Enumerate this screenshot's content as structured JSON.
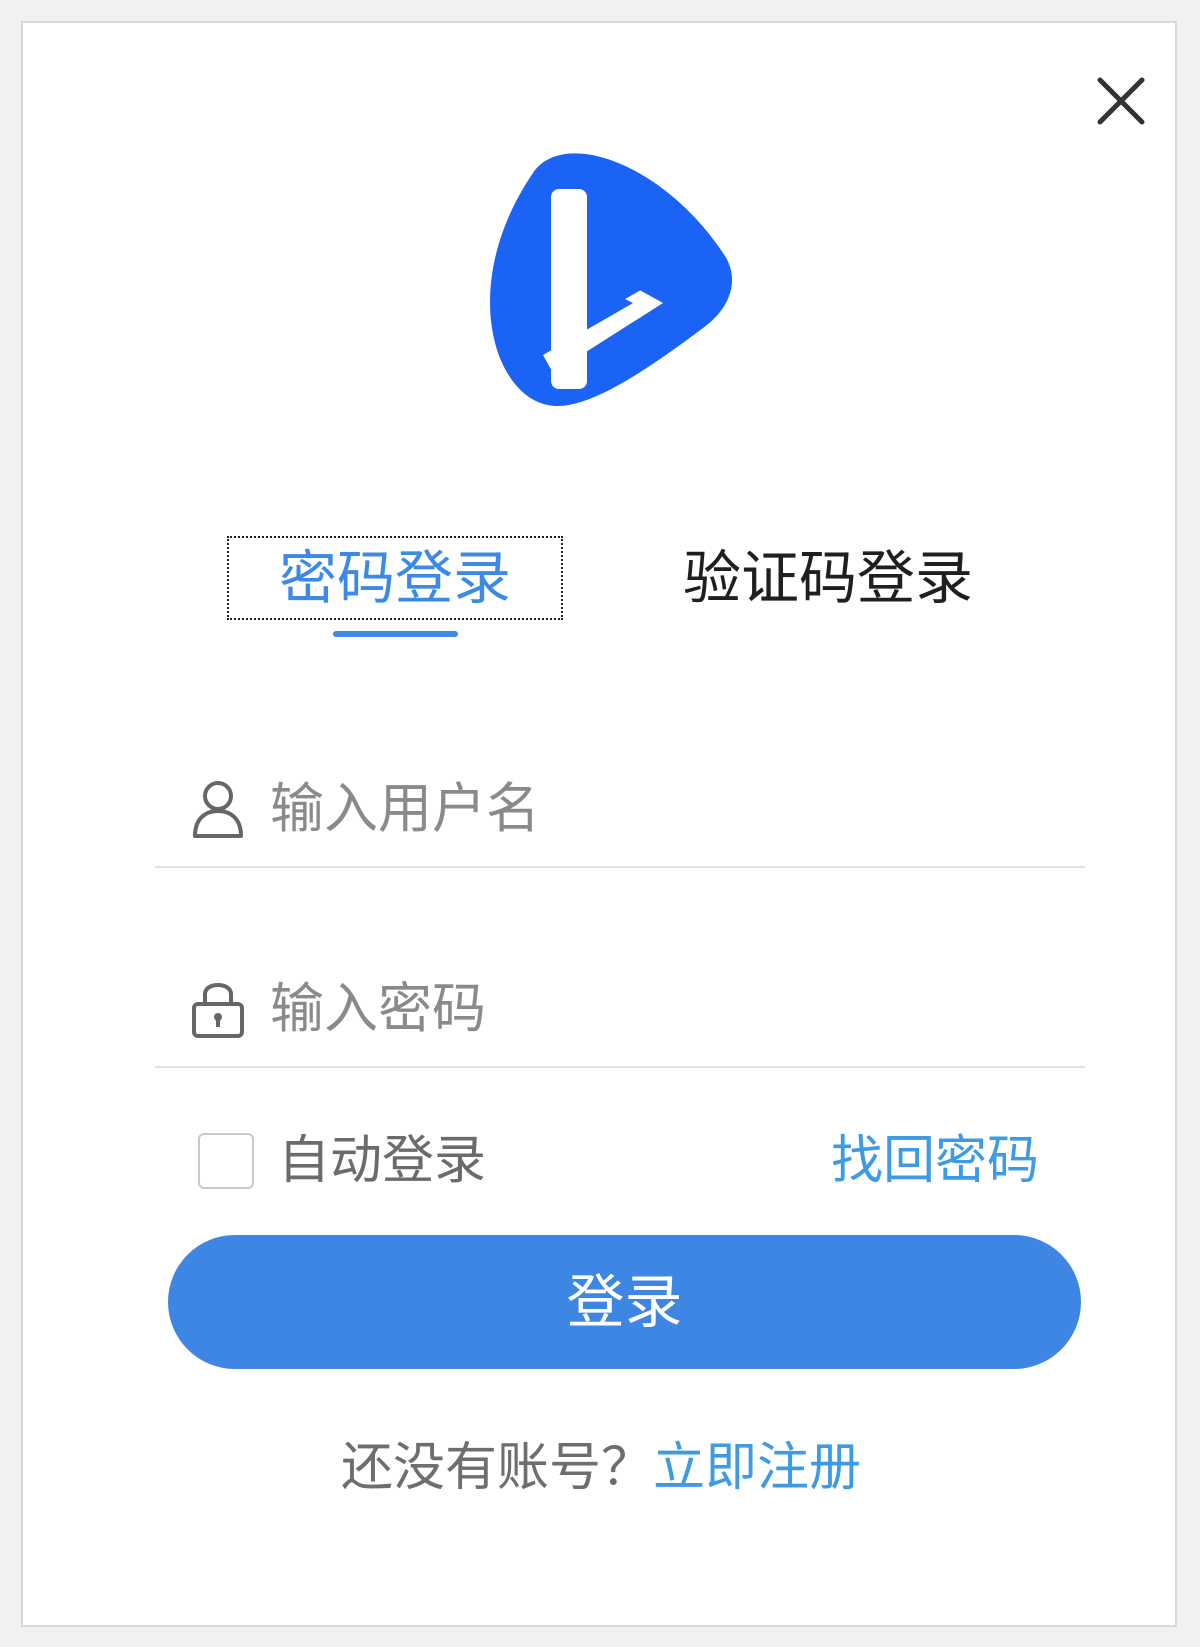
{
  "window": {
    "close_icon": "close-icon"
  },
  "logo": {
    "icon": "play-logo-icon",
    "color": "#1a63f5"
  },
  "tabs": [
    {
      "label": "密码登录",
      "active": true
    },
    {
      "label": "验证码登录",
      "active": false
    }
  ],
  "form": {
    "username": {
      "placeholder": "输入用户名",
      "value": "",
      "icon": "user-icon"
    },
    "password": {
      "placeholder": "输入密码",
      "value": "",
      "icon": "lock-icon"
    },
    "auto_login": {
      "label": "自动登录",
      "checked": false
    },
    "forgot_password": "找回密码",
    "submit_label": "登录"
  },
  "register": {
    "prompt": "还没有账号？",
    "link": "立即注册"
  },
  "colors": {
    "accent": "#3e86e3",
    "link": "#3d9be6",
    "logo": "#1a63f5"
  }
}
